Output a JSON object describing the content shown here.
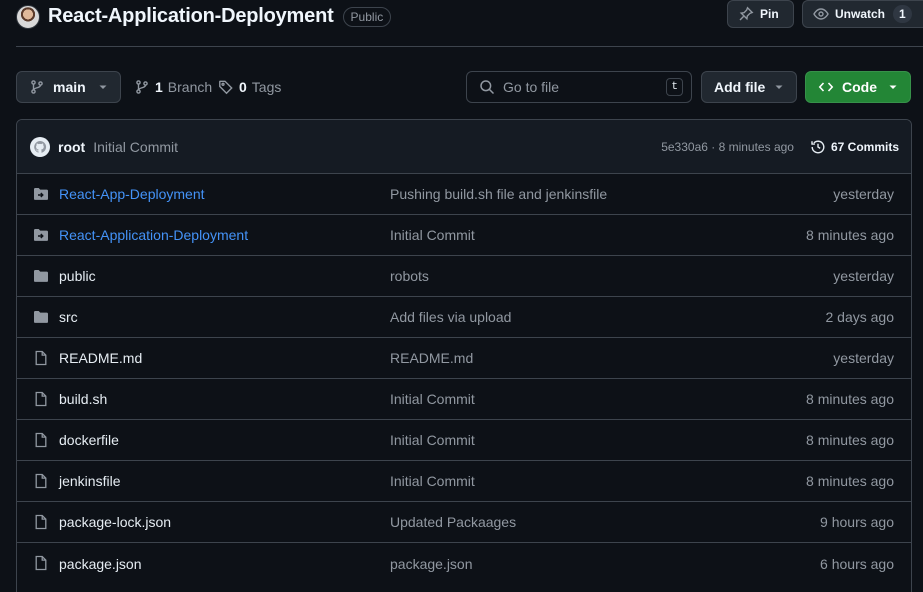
{
  "repo": {
    "name": "React-Application-Deployment",
    "visibility": "Public"
  },
  "header_actions": {
    "pin_label": "Pin",
    "watch_label": "Unwatch",
    "watch_count": "1"
  },
  "toolbar": {
    "branch": "main",
    "branches_count": "1",
    "branches_label": "Branch",
    "tags_count": "0",
    "tags_label": "Tags",
    "search_placeholder": "Go to file",
    "search_shortcut": "t",
    "add_file_label": "Add file",
    "code_label": "Code"
  },
  "latest_commit": {
    "author": "root",
    "message": "Initial Commit",
    "meta": "5e330a6 · 8 minutes ago",
    "commits_label": "67 Commits"
  },
  "files": [
    {
      "name": "React-App-Deployment",
      "type": "submodule",
      "message": "Pushing build.sh file and jenkinsfile",
      "date": "yesterday"
    },
    {
      "name": "React-Application-Deployment",
      "type": "submodule",
      "message": "Initial Commit",
      "date": "8 minutes ago"
    },
    {
      "name": "public",
      "type": "folder",
      "message": "robots",
      "date": "yesterday"
    },
    {
      "name": "src",
      "type": "folder",
      "message": "Add files via upload",
      "date": "2 days ago"
    },
    {
      "name": "README.md",
      "type": "file",
      "message": "README.md",
      "date": "yesterday"
    },
    {
      "name": "build.sh",
      "type": "file",
      "message": "Initial Commit",
      "date": "8 minutes ago"
    },
    {
      "name": "dockerfile",
      "type": "file",
      "message": "Initial Commit",
      "date": "8 minutes ago"
    },
    {
      "name": "jenkinsfile",
      "type": "file",
      "message": "Initial Commit",
      "date": "8 minutes ago"
    },
    {
      "name": "package-lock.json",
      "type": "file",
      "message": "Updated Packaages",
      "date": "9 hours ago"
    },
    {
      "name": "package.json",
      "type": "file",
      "message": "package.json",
      "date": "6 hours ago"
    }
  ],
  "colors": {
    "background": "#0d1117",
    "link": "#4493f8",
    "code_button": "#238636",
    "muted_text": "#9198a1"
  }
}
